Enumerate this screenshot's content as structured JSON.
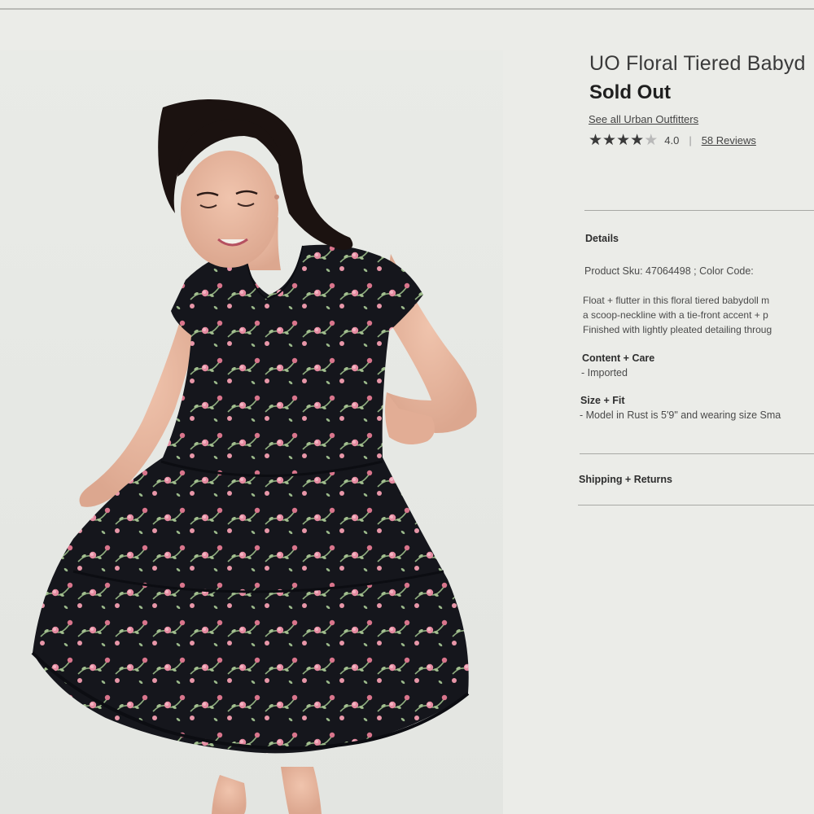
{
  "product": {
    "title": "UO Floral Tiered Babyd",
    "status": "Sold Out",
    "brand_link": "See all Urban Outfitters",
    "rating": {
      "stars_filled": 4,
      "stars_total": 5,
      "value": "4.0",
      "separator": "|",
      "reviews_link": "58 Reviews"
    }
  },
  "details": {
    "heading": "Details",
    "sku_line": "Product Sku: 47064498 ; Color Code:",
    "description": [
      "Float + flutter in this floral tiered babydoll m",
      "a scoop-neckline with a tie-front accent + p",
      "Finished with lightly pleated detailing throug"
    ],
    "content_care": {
      "heading": "Content + Care",
      "text": "- Imported"
    },
    "size_fit": {
      "heading": "Size + Fit",
      "text": "- Model in Rust is 5'9\" and wearing size Sma"
    }
  },
  "shipping": {
    "heading": "Shipping + Returns"
  },
  "icons": {
    "star_filled": "★",
    "star_empty": "★"
  },
  "colors": {
    "dress": "#15161c",
    "rose": "#e7899c",
    "leaf": "#9ab88a",
    "skin": "#e9b9a0"
  }
}
